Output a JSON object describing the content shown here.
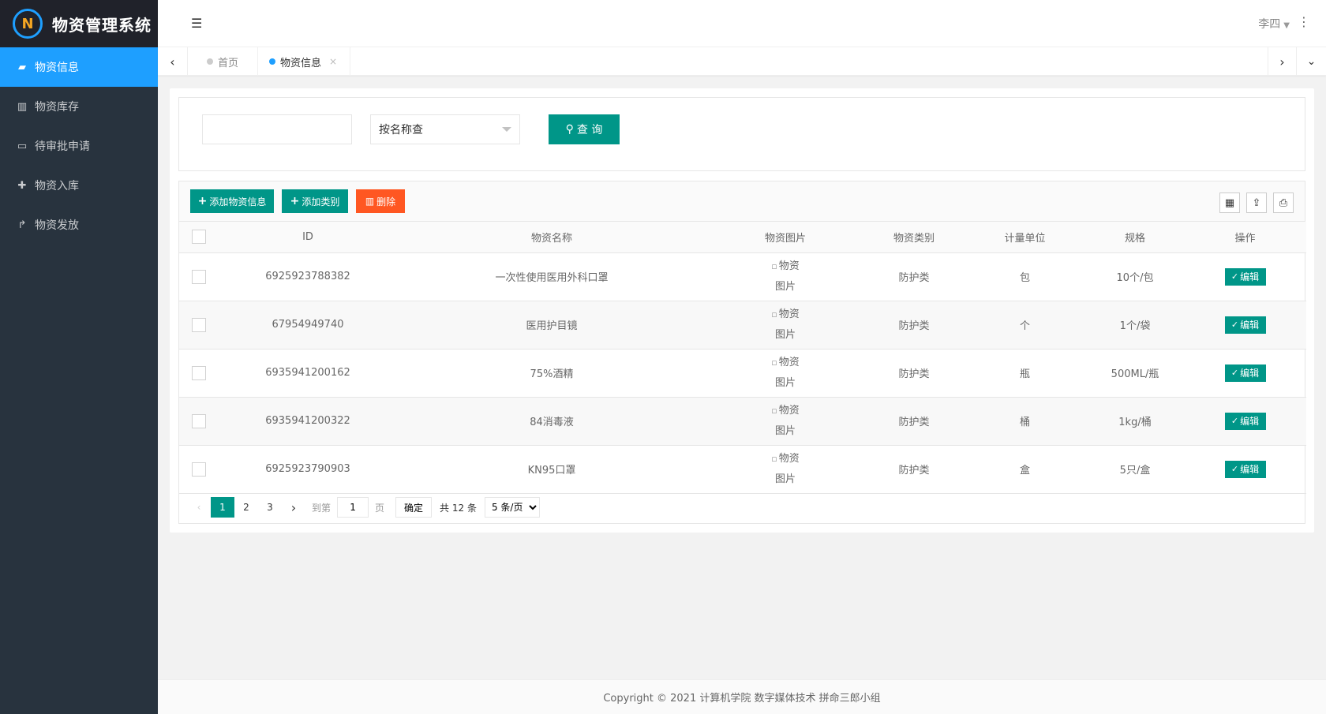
{
  "app": {
    "title": "物资管理系统",
    "logo_mark": "N"
  },
  "sidebar": {
    "items": [
      {
        "label": "物资信息",
        "icon": "book-icon",
        "glyph": "▰",
        "active": true
      },
      {
        "label": "物资库存",
        "icon": "bar-chart-icon",
        "glyph": "▥",
        "active": false
      },
      {
        "label": "待审批申请",
        "icon": "monitor-icon",
        "glyph": "▭",
        "active": false
      },
      {
        "label": "物资入库",
        "icon": "plus-icon",
        "glyph": "✚",
        "active": false
      },
      {
        "label": "物资发放",
        "icon": "share-icon",
        "glyph": "↱",
        "active": false
      }
    ]
  },
  "header": {
    "menu_glyph": "☰",
    "user_name": "李四",
    "caret": "▼",
    "more_glyph": "⋮"
  },
  "tabs": {
    "prev": "‹",
    "next": "›",
    "down": "⌄",
    "items": [
      {
        "label": "首页",
        "active": false
      },
      {
        "label": "物资信息",
        "active": true,
        "close": "×"
      }
    ]
  },
  "search": {
    "input_value": "",
    "select_value": "按名称查",
    "button_label": "查 询",
    "button_glyph": "⚲"
  },
  "toolbar": {
    "add_info_label": "添加物资信息",
    "add_category_label": "添加类别",
    "delete_label": "删除",
    "plus_glyph": "+",
    "trash_glyph": "▥",
    "columns_glyph": "▦",
    "export_glyph": "⇪",
    "print_glyph": "⎙"
  },
  "table": {
    "headers": [
      "ID",
      "物资名称",
      "物资图片",
      "物资类别",
      "计量单位",
      "规格",
      "操作"
    ],
    "image_alt_line1": "物资",
    "image_alt_line2": "图片",
    "edit_label": "编辑",
    "edit_glyph": "✓",
    "rows": [
      {
        "id": "6925923788382",
        "name": "一次性使用医用外科口罩",
        "category": "防护类",
        "unit": "包",
        "spec": "10个/包"
      },
      {
        "id": "67954949740",
        "name": "医用护目镜",
        "category": "防护类",
        "unit": "个",
        "spec": "1个/袋"
      },
      {
        "id": "6935941200162",
        "name": "75%酒精",
        "category": "防护类",
        "unit": "瓶",
        "spec": "500ML/瓶"
      },
      {
        "id": "6935941200322",
        "name": "84消毒液",
        "category": "防护类",
        "unit": "桶",
        "spec": "1kg/桶"
      },
      {
        "id": "6925923790903",
        "name": "KN95口罩",
        "category": "防护类",
        "unit": "盒",
        "spec": "5只/盒"
      }
    ]
  },
  "pager": {
    "prev": "‹",
    "next": "›",
    "pages": [
      "1",
      "2",
      "3"
    ],
    "current": "1",
    "goto_label": "到第",
    "goto_value": "1",
    "page_unit": "页",
    "confirm_label": "确定",
    "total_label": "共 12 条",
    "page_size": "5 条/页"
  },
  "footer": {
    "text": "Copyright © 2021 计算机学院 数字媒体技术 拼命三郎小组"
  }
}
